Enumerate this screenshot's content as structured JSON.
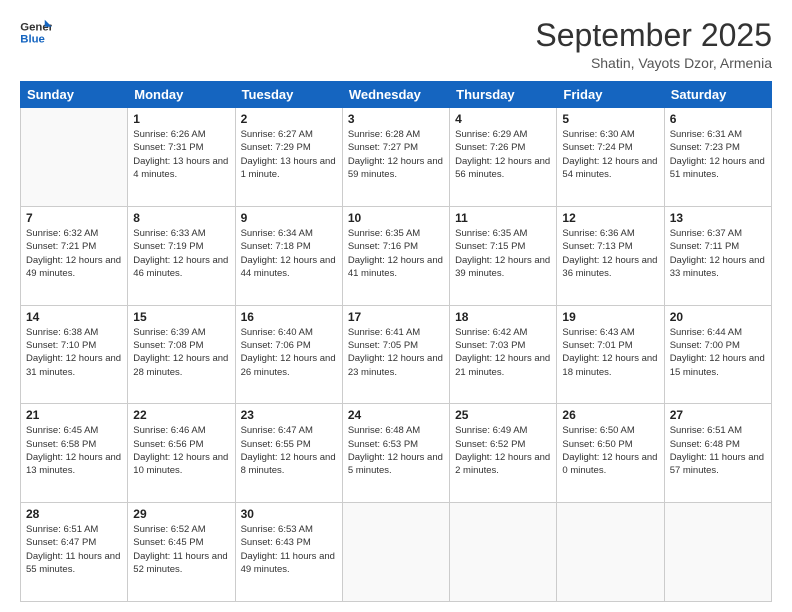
{
  "logo": {
    "line1": "General",
    "line2": "Blue"
  },
  "title": "September 2025",
  "subtitle": "Shatin, Vayots Dzor, Armenia",
  "header_days": [
    "Sunday",
    "Monday",
    "Tuesday",
    "Wednesday",
    "Thursday",
    "Friday",
    "Saturday"
  ],
  "weeks": [
    [
      {
        "day": "",
        "sunrise": "",
        "sunset": "",
        "daylight": ""
      },
      {
        "day": "1",
        "sunrise": "Sunrise: 6:26 AM",
        "sunset": "Sunset: 7:31 PM",
        "daylight": "Daylight: 13 hours and 4 minutes."
      },
      {
        "day": "2",
        "sunrise": "Sunrise: 6:27 AM",
        "sunset": "Sunset: 7:29 PM",
        "daylight": "Daylight: 13 hours and 1 minute."
      },
      {
        "day": "3",
        "sunrise": "Sunrise: 6:28 AM",
        "sunset": "Sunset: 7:27 PM",
        "daylight": "Daylight: 12 hours and 59 minutes."
      },
      {
        "day": "4",
        "sunrise": "Sunrise: 6:29 AM",
        "sunset": "Sunset: 7:26 PM",
        "daylight": "Daylight: 12 hours and 56 minutes."
      },
      {
        "day": "5",
        "sunrise": "Sunrise: 6:30 AM",
        "sunset": "Sunset: 7:24 PM",
        "daylight": "Daylight: 12 hours and 54 minutes."
      },
      {
        "day": "6",
        "sunrise": "Sunrise: 6:31 AM",
        "sunset": "Sunset: 7:23 PM",
        "daylight": "Daylight: 12 hours and 51 minutes."
      }
    ],
    [
      {
        "day": "7",
        "sunrise": "Sunrise: 6:32 AM",
        "sunset": "Sunset: 7:21 PM",
        "daylight": "Daylight: 12 hours and 49 minutes."
      },
      {
        "day": "8",
        "sunrise": "Sunrise: 6:33 AM",
        "sunset": "Sunset: 7:19 PM",
        "daylight": "Daylight: 12 hours and 46 minutes."
      },
      {
        "day": "9",
        "sunrise": "Sunrise: 6:34 AM",
        "sunset": "Sunset: 7:18 PM",
        "daylight": "Daylight: 12 hours and 44 minutes."
      },
      {
        "day": "10",
        "sunrise": "Sunrise: 6:35 AM",
        "sunset": "Sunset: 7:16 PM",
        "daylight": "Daylight: 12 hours and 41 minutes."
      },
      {
        "day": "11",
        "sunrise": "Sunrise: 6:35 AM",
        "sunset": "Sunset: 7:15 PM",
        "daylight": "Daylight: 12 hours and 39 minutes."
      },
      {
        "day": "12",
        "sunrise": "Sunrise: 6:36 AM",
        "sunset": "Sunset: 7:13 PM",
        "daylight": "Daylight: 12 hours and 36 minutes."
      },
      {
        "day": "13",
        "sunrise": "Sunrise: 6:37 AM",
        "sunset": "Sunset: 7:11 PM",
        "daylight": "Daylight: 12 hours and 33 minutes."
      }
    ],
    [
      {
        "day": "14",
        "sunrise": "Sunrise: 6:38 AM",
        "sunset": "Sunset: 7:10 PM",
        "daylight": "Daylight: 12 hours and 31 minutes."
      },
      {
        "day": "15",
        "sunrise": "Sunrise: 6:39 AM",
        "sunset": "Sunset: 7:08 PM",
        "daylight": "Daylight: 12 hours and 28 minutes."
      },
      {
        "day": "16",
        "sunrise": "Sunrise: 6:40 AM",
        "sunset": "Sunset: 7:06 PM",
        "daylight": "Daylight: 12 hours and 26 minutes."
      },
      {
        "day": "17",
        "sunrise": "Sunrise: 6:41 AM",
        "sunset": "Sunset: 7:05 PM",
        "daylight": "Daylight: 12 hours and 23 minutes."
      },
      {
        "day": "18",
        "sunrise": "Sunrise: 6:42 AM",
        "sunset": "Sunset: 7:03 PM",
        "daylight": "Daylight: 12 hours and 21 minutes."
      },
      {
        "day": "19",
        "sunrise": "Sunrise: 6:43 AM",
        "sunset": "Sunset: 7:01 PM",
        "daylight": "Daylight: 12 hours and 18 minutes."
      },
      {
        "day": "20",
        "sunrise": "Sunrise: 6:44 AM",
        "sunset": "Sunset: 7:00 PM",
        "daylight": "Daylight: 12 hours and 15 minutes."
      }
    ],
    [
      {
        "day": "21",
        "sunrise": "Sunrise: 6:45 AM",
        "sunset": "Sunset: 6:58 PM",
        "daylight": "Daylight: 12 hours and 13 minutes."
      },
      {
        "day": "22",
        "sunrise": "Sunrise: 6:46 AM",
        "sunset": "Sunset: 6:56 PM",
        "daylight": "Daylight: 12 hours and 10 minutes."
      },
      {
        "day": "23",
        "sunrise": "Sunrise: 6:47 AM",
        "sunset": "Sunset: 6:55 PM",
        "daylight": "Daylight: 12 hours and 8 minutes."
      },
      {
        "day": "24",
        "sunrise": "Sunrise: 6:48 AM",
        "sunset": "Sunset: 6:53 PM",
        "daylight": "Daylight: 12 hours and 5 minutes."
      },
      {
        "day": "25",
        "sunrise": "Sunrise: 6:49 AM",
        "sunset": "Sunset: 6:52 PM",
        "daylight": "Daylight: 12 hours and 2 minutes."
      },
      {
        "day": "26",
        "sunrise": "Sunrise: 6:50 AM",
        "sunset": "Sunset: 6:50 PM",
        "daylight": "Daylight: 12 hours and 0 minutes."
      },
      {
        "day": "27",
        "sunrise": "Sunrise: 6:51 AM",
        "sunset": "Sunset: 6:48 PM",
        "daylight": "Daylight: 11 hours and 57 minutes."
      }
    ],
    [
      {
        "day": "28",
        "sunrise": "Sunrise: 6:51 AM",
        "sunset": "Sunset: 6:47 PM",
        "daylight": "Daylight: 11 hours and 55 minutes."
      },
      {
        "day": "29",
        "sunrise": "Sunrise: 6:52 AM",
        "sunset": "Sunset: 6:45 PM",
        "daylight": "Daylight: 11 hours and 52 minutes."
      },
      {
        "day": "30",
        "sunrise": "Sunrise: 6:53 AM",
        "sunset": "Sunset: 6:43 PM",
        "daylight": "Daylight: 11 hours and 49 minutes."
      },
      {
        "day": "",
        "sunrise": "",
        "sunset": "",
        "daylight": ""
      },
      {
        "day": "",
        "sunrise": "",
        "sunset": "",
        "daylight": ""
      },
      {
        "day": "",
        "sunrise": "",
        "sunset": "",
        "daylight": ""
      },
      {
        "day": "",
        "sunrise": "",
        "sunset": "",
        "daylight": ""
      }
    ]
  ]
}
